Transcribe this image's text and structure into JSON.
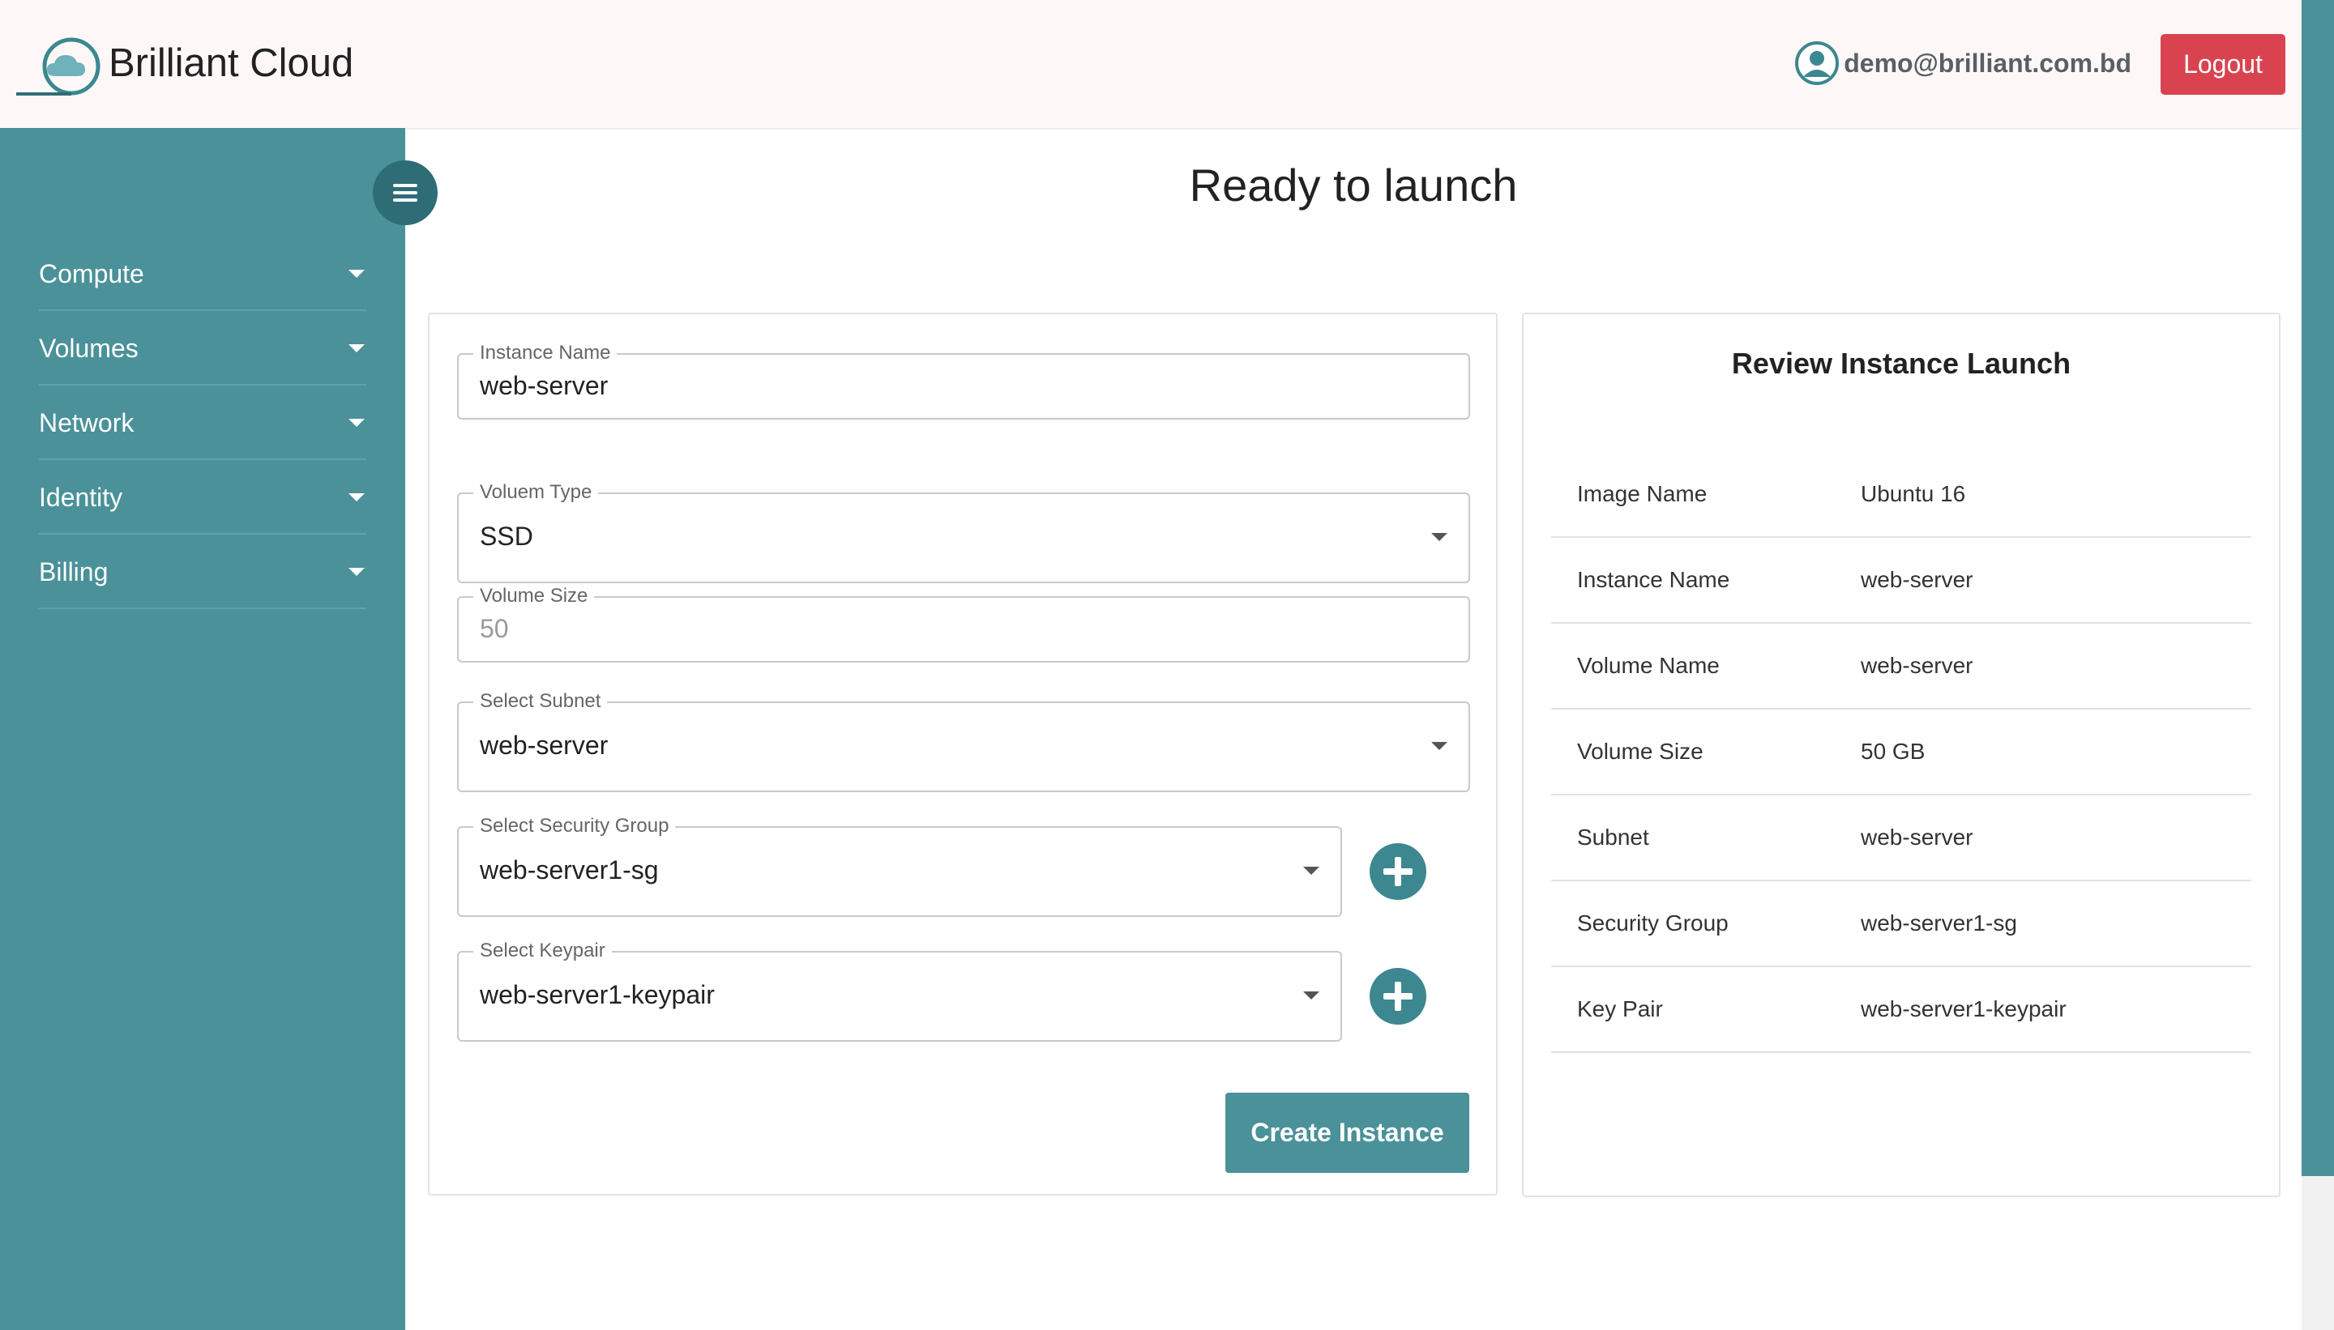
{
  "header": {
    "brand": "Brilliant Cloud",
    "user_email": "demo@brilliant.com.bd",
    "logout_label": "Logout"
  },
  "sidebar": {
    "items": [
      {
        "label": "Compute"
      },
      {
        "label": "Volumes"
      },
      {
        "label": "Network"
      },
      {
        "label": "Identity"
      },
      {
        "label": "Billing"
      }
    ]
  },
  "page": {
    "title": "Ready to launch"
  },
  "form": {
    "instance_name": {
      "label": "Instance Name",
      "value": "web-server"
    },
    "volume_type": {
      "label": "Voluem Type",
      "value": "SSD"
    },
    "volume_size": {
      "label": "Volume Size",
      "value": "50"
    },
    "subnet": {
      "label": "Select Subnet",
      "value": "web-server"
    },
    "security_group": {
      "label": "Select Security Group",
      "value": "web-server1-sg"
    },
    "keypair": {
      "label": "Select Keypair",
      "value": "web-server1-keypair"
    },
    "create_label": "Create Instance"
  },
  "review": {
    "title": "Review Instance Launch",
    "rows": [
      {
        "key": "Image Name",
        "value": "Ubuntu 16"
      },
      {
        "key": "Instance Name",
        "value": "web-server"
      },
      {
        "key": "Volume Name",
        "value": "web-server"
      },
      {
        "key": "Volume Size",
        "value": "50 GB"
      },
      {
        "key": "Subnet",
        "value": "web-server"
      },
      {
        "key": "Security Group",
        "value": "web-server1-sg"
      },
      {
        "key": "Key Pair",
        "value": "web-server1-keypair"
      }
    ]
  },
  "colors": {
    "sidebar": "#4a9199",
    "accent_dark": "#2e6d75",
    "logout": "#d9434f",
    "header_bg": "#fdf8f7"
  }
}
